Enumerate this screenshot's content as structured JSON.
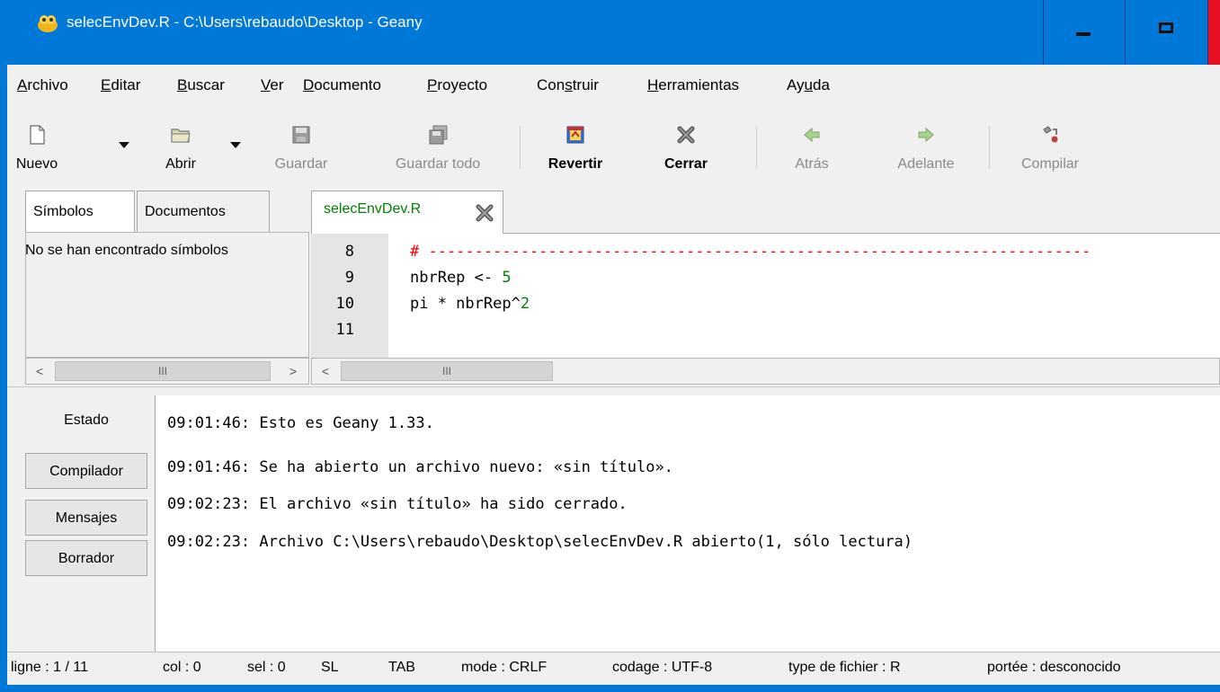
{
  "window": {
    "title": "selecEnvDev.R - C:\\Users\\rebaudo\\Desktop - Geany",
    "accent": "#0078d7"
  },
  "menu": [
    {
      "accel": "A",
      "rest": "rchivo"
    },
    {
      "accel": "E",
      "rest": "ditar"
    },
    {
      "accel": "B",
      "rest": "uscar"
    },
    {
      "accel": "V",
      "rest": "er"
    },
    {
      "accel": "D",
      "rest": "ocumento"
    },
    {
      "accel": "P",
      "rest": "royecto"
    },
    {
      "pre": "Con",
      "accel": "s",
      "rest": "truir"
    },
    {
      "accel": "H",
      "rest": "erramientas"
    },
    {
      "pre": "Ay",
      "accel": "u",
      "rest": "da"
    }
  ],
  "toolbar": {
    "nuevo": "Nuevo",
    "abrir": "Abrir",
    "guardar": "Guardar",
    "guardar_todo": "Guardar todo",
    "revertir": "Revertir",
    "cerrar": "Cerrar",
    "atras": "Atrás",
    "adelante": "Adelante",
    "compilar": "Compilar"
  },
  "sidebar": {
    "tabs": [
      "Símbolos",
      "Documentos"
    ],
    "message": "No se han encontrado símbolos"
  },
  "editor": {
    "tab_label": "selecEnvDev.R",
    "lines": [
      {
        "n": "8",
        "parts": [
          {
            "t": "# ------------------------------------------------------------------------",
            "c": "cmt"
          }
        ]
      },
      {
        "n": "9",
        "parts": [
          {
            "t": "nbrRep <- ",
            "c": ""
          },
          {
            "t": "5",
            "c": "num"
          }
        ]
      },
      {
        "n": "10",
        "parts": [
          {
            "t": "pi * nbrRep^",
            "c": ""
          },
          {
            "t": "2",
            "c": "num"
          }
        ]
      },
      {
        "n": "11",
        "parts": []
      }
    ],
    "colors": {
      "number": "#008000",
      "comment": "#ff0000"
    }
  },
  "scroll_glyphs": {
    "left": "<",
    "right": ">",
    "grip": "III"
  },
  "messages": {
    "tabs": [
      "Estado",
      "Compilador",
      "Mensajes",
      "Borrador"
    ],
    "lines": [
      "09:01:46: Esto es Geany 1.33.",
      "09:01:46: Se ha abierto un archivo nuevo: «sin título».",
      "09:02:23: El archivo «sin título» ha sido cerrado.",
      "09:02:23: Archivo C:\\Users\\rebaudo\\Desktop\\selecEnvDev.R abierto(1, sólo lectura)"
    ]
  },
  "statusbar": {
    "ligne": "ligne : 1 / 11",
    "col": "col : 0",
    "sel": "sel : 0",
    "sl": "SL",
    "tab": "TAB",
    "mode": "mode : CRLF",
    "codage": "codage : UTF-8",
    "type": "type de fichier : R",
    "portee": "portée : desconocido"
  }
}
